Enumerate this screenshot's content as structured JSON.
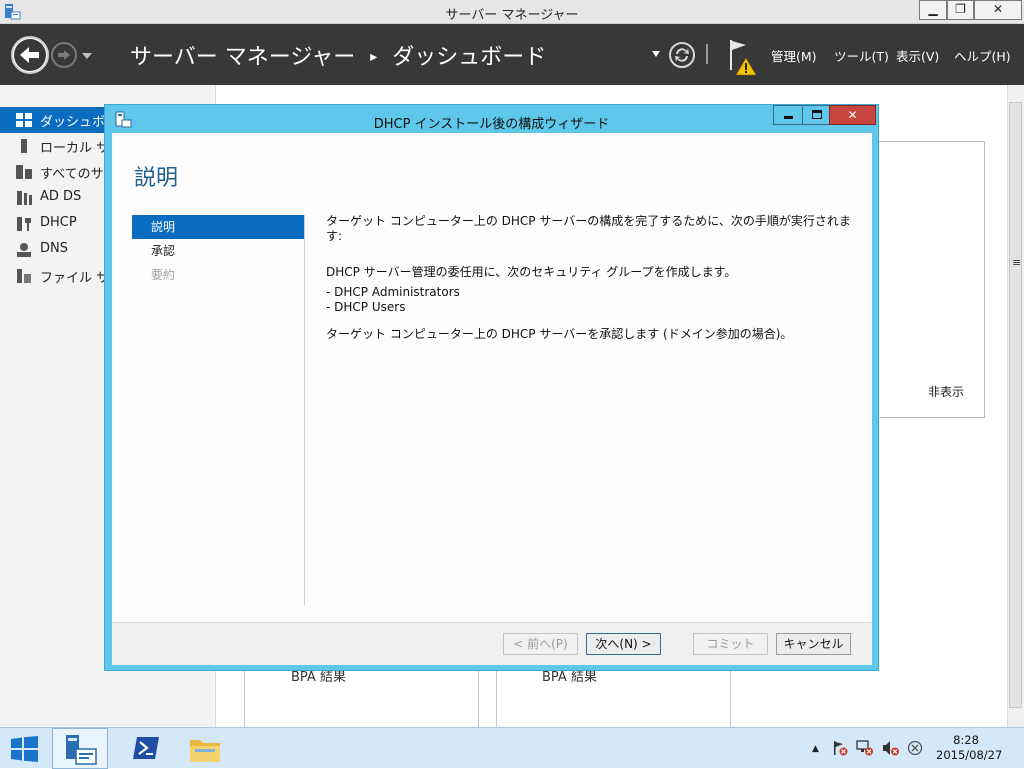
{
  "window": {
    "title": "サーバー マネージャー",
    "minimize": "▁",
    "restore": "❐",
    "close": "✕"
  },
  "header": {
    "breadcrumb_root": "サーバー マネージャー",
    "breadcrumb_sep": "▸",
    "breadcrumb_current": "ダッシュボード",
    "menu": [
      "管理(M)",
      "ツール(T)",
      "表示(V)",
      "ヘルプ(H)"
    ]
  },
  "sidebar": {
    "items": [
      {
        "label": "ダッシュボード",
        "icon": "dashboard-icon"
      },
      {
        "label": "ローカル サーバー",
        "icon": "local-server-icon"
      },
      {
        "label": "すべてのサーバー",
        "icon": "all-servers-icon"
      },
      {
        "label": "AD DS",
        "icon": "ad-ds-icon"
      },
      {
        "label": "DHCP",
        "icon": "dhcp-icon"
      },
      {
        "label": "DNS",
        "icon": "dns-icon"
      },
      {
        "label": "ファイル サービス",
        "icon": "file-services-icon"
      }
    ]
  },
  "background": {
    "hide_label": "非表示",
    "bpa_label": "BPA 結果"
  },
  "dialog": {
    "title": "DHCP インストール後の構成ウィザード",
    "heading": "説明",
    "nav": [
      "説明",
      "承認",
      "要約"
    ],
    "content": {
      "line1": "ターゲット コンピューター上の DHCP サーバーの構成を完了するために、次の手順が実行されます:",
      "line2": "DHCP サーバー管理の委任用に、次のセキュリティ グループを作成します。",
      "group1": "- DHCP Administrators",
      "group2": "- DHCP Users",
      "line3": "ターゲット コンピューター上の DHCP サーバーを承認します (ドメイン参加の場合)。"
    },
    "buttons": {
      "prev": "< 前へ(P)",
      "next": "次へ(N) >",
      "commit": "コミット",
      "cancel": "キャンセル"
    }
  },
  "taskbar": {
    "time": "8:28",
    "date": "2015/08/27"
  },
  "colors": {
    "header_bg": "#383838",
    "accent": "#0a6cc1",
    "dialog_frame": "#5ec7ea",
    "close_red": "#c7453c"
  }
}
